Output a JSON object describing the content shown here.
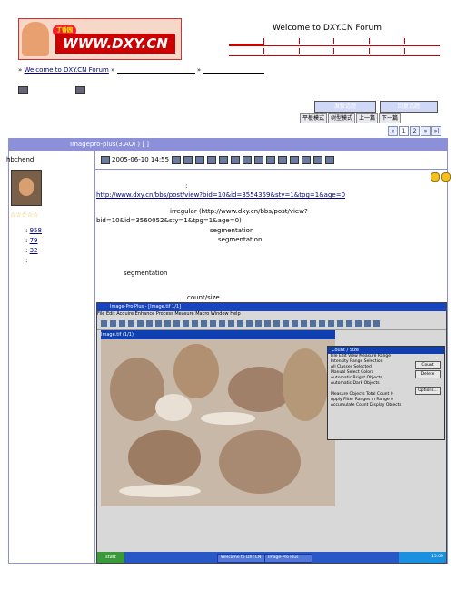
{
  "header": {
    "welcome": "Welcome to DXY.CN Forum",
    "logo_badge": "丁香园",
    "logo_text": "WWW.DXY.CN"
  },
  "breadcrumb": {
    "prefix": "»",
    "forum_link": "Welcome to DXY.CN Forum",
    "sep": "»"
  },
  "buttons": {
    "new_topic": "发新话题",
    "reply": "回复话题",
    "view_mode": "平板模式",
    "tree_mode": "树型模式",
    "prev": "上一篇",
    "next": "下一篇"
  },
  "pager": [
    "«",
    "1",
    "2",
    "»",
    "»|"
  ],
  "thread": {
    "title": "Imagepro-plus(3.AOI          )  [        ]"
  },
  "post": {
    "author": "hbchendl",
    "stars": "☆☆☆☆☆",
    "stat1_label": ":",
    "stat1": "958",
    "stat2_label": ":",
    "stat2": "79",
    "stat3_label": ":",
    "stat3": "32",
    "stat4_label": ":",
    "date": "2005-06-10 14:55",
    "colon": ":",
    "link1": "http://www.dxy.cn/bbs/post/view?bid=10&id=3554359&sty=1&tpg=1&age=0",
    "line_irregular": "irregular          (http://www.dxy.cn/bbs/post/view?",
    "line_bid": "bid=10&id=3560052&sty=1&tpg=1&age=0)",
    "seg1": "segmentation",
    "seg2": "segmentation",
    "seg3": "segmentation",
    "countsize": "count/size"
  },
  "screenshot": {
    "app_title": "Image-Pro Plus - [Image.tif 1/1]",
    "menu": "File  Edit  Acquire  Enhance  Process  Measure  Macro  Window  Help",
    "inner_title": "Image.tif (1/1)",
    "dialog_title": "Count / Size",
    "dialog_menu": "File  Edit  View  Measure  Range",
    "dialog_lines": [
      "Intensity Range Selection",
      "All Classes Selected",
      "Manual      Select Colors",
      "Automatic Bright Objects",
      "Automatic Dark Objects",
      "",
      "Measure Objects    Total Count   0",
      "Apply Filter Ranges  In Range    0",
      "Accumulate Count   Display Objects"
    ],
    "btn_count": "Count",
    "btn_delete": "Delete",
    "btn_options": "Options...",
    "taskbar_start": "start",
    "task1": "Welcome to DXY.CN",
    "task2": "Image-Pro Plus",
    "tray_time": "15:09"
  }
}
